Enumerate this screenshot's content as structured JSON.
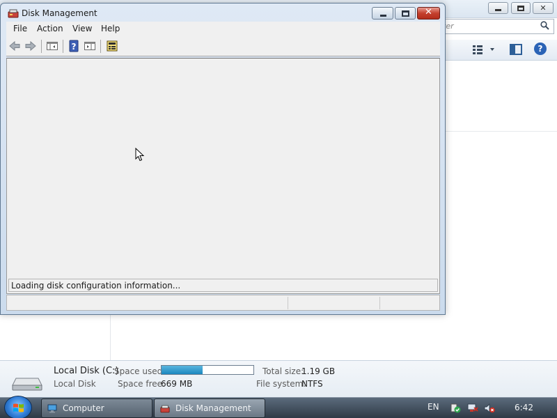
{
  "background_window": {
    "search_placeholder": "ter",
    "search_icon": "search-icon",
    "views_icon": "views-icon",
    "preview_pane_icon": "preview-pane-icon",
    "help_icon": "help-icon"
  },
  "dm_window": {
    "title": "Disk Management",
    "caption_close": "✕",
    "menu": [
      "File",
      "Action",
      "View",
      "Help"
    ],
    "toolbar_icons": [
      "back-icon",
      "forward-icon",
      "show-hide-console-tree-icon",
      "help-icon",
      "show-hide-action-pane-icon",
      "properties-icon"
    ],
    "loading_text": "Loading disk configuration information..."
  },
  "details_pane": {
    "drive_name": "Local Disk (C:)",
    "drive_type": "Local Disk",
    "space_used_label": "Space used:",
    "space_used_fraction": 0.45,
    "space_free_label": "Space free:",
    "space_free_value": "669 MB",
    "total_size_label": "Total size:",
    "total_size_value": "1.19 GB",
    "file_system_label": "File system:",
    "file_system_value": "NTFS"
  },
  "taskbar": {
    "start_icon": "windows-start-icon",
    "tasks": [
      {
        "label": "Computer",
        "icon": "computer-icon"
      },
      {
        "label": "Disk Management",
        "icon": "disk-management-icon"
      }
    ],
    "language": "EN",
    "tray_icons": [
      "action-center-icon",
      "network-icon",
      "volume-muted-icon"
    ],
    "clock": "6:42"
  }
}
